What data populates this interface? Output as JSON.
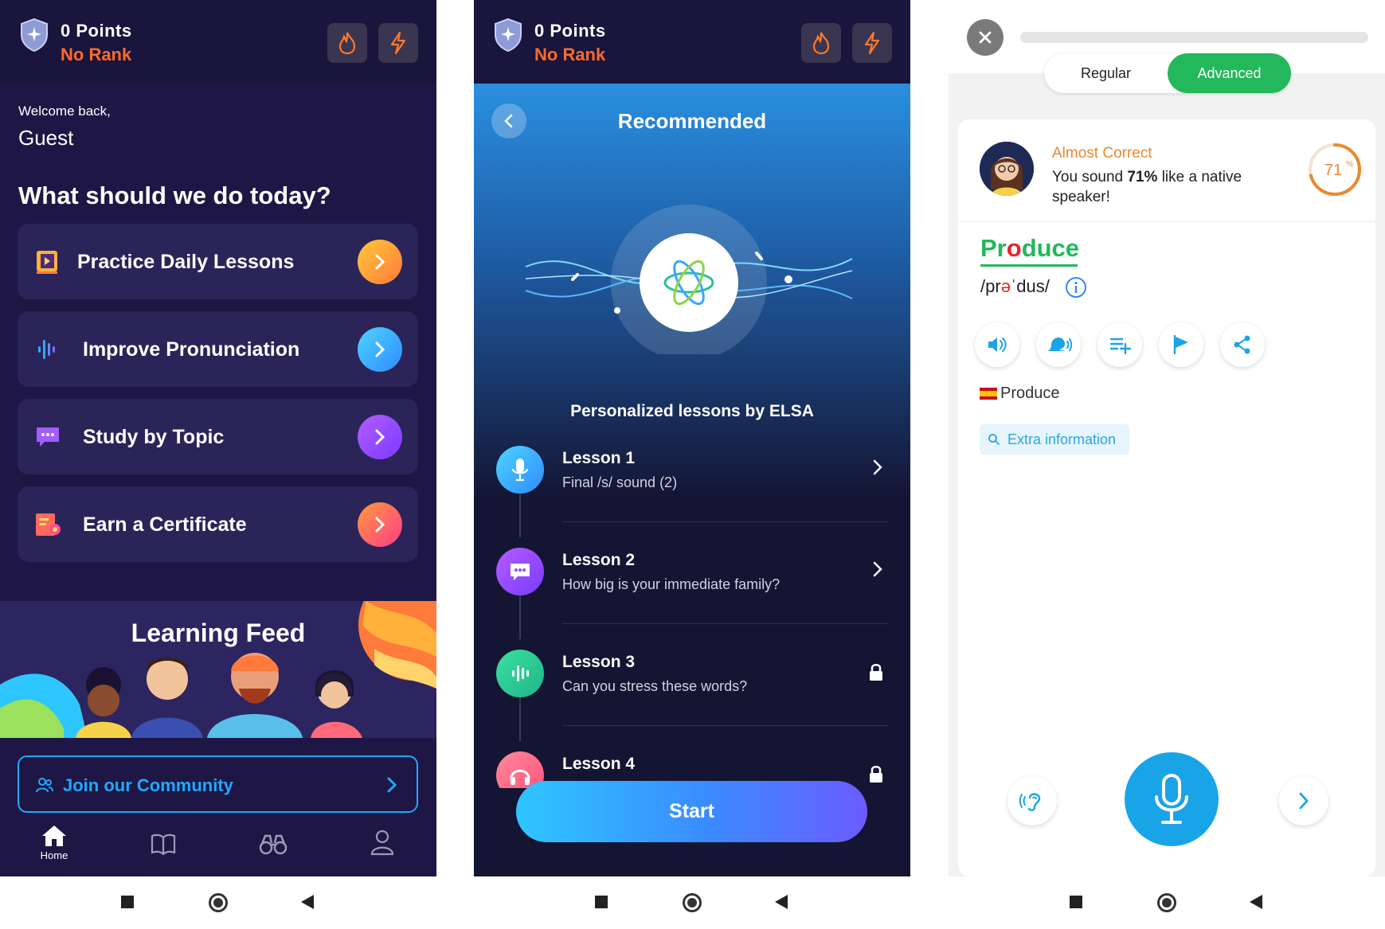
{
  "colors": {
    "accent_blue": "#1fa9ff",
    "rank_orange": "#ff6a2b",
    "green": "#22b85b",
    "elsa_red": "#e8232b"
  },
  "home": {
    "points": "0 Points",
    "rank": "No Rank",
    "welcome": "Welcome back,",
    "user": "Guest",
    "question": "What should we do today?",
    "cards": [
      {
        "label": "Practice Daily Lessons",
        "icon": "book-video-icon"
      },
      {
        "label": "Improve Pronunciation",
        "icon": "sound-wave-icon"
      },
      {
        "label": "Study by Topic",
        "icon": "chat-bubble-icon"
      },
      {
        "label": "Earn a Certificate",
        "icon": "certificate-icon"
      }
    ],
    "feed_title": "Learning Feed",
    "community": "Join our Community",
    "tabs": [
      {
        "label": "Home",
        "icon": "home-icon"
      },
      {
        "label": "",
        "icon": "book-icon"
      },
      {
        "label": "",
        "icon": "binoculars-icon"
      },
      {
        "label": "",
        "icon": "profile-icon"
      }
    ]
  },
  "recommended": {
    "points": "0 Points",
    "rank": "No Rank",
    "title": "Recommended",
    "subtitle": "Personalized lessons by ELSA",
    "lessons": [
      {
        "title": "Lesson 1",
        "desc": "Final /s/ sound (2)",
        "state": "open"
      },
      {
        "title": "Lesson 2",
        "desc": "How big is your immediate family?",
        "state": "open"
      },
      {
        "title": "Lesson 3",
        "desc": "Can you stress these words?",
        "state": "locked"
      },
      {
        "title": "Lesson 4",
        "desc": "",
        "state": "locked"
      }
    ],
    "start": "Start"
  },
  "practice": {
    "mode_regular": "Regular",
    "mode_advanced": "Advanced",
    "selected_mode": "Advanced",
    "feedback": "Almost Correct",
    "score_prefix": "You sound ",
    "score": "71%",
    "score_suffix": " like a native speaker!",
    "ring_value": "71",
    "ring_unit": "%",
    "ring_fraction": 0.71,
    "word_parts": [
      "Pr",
      "o",
      "duce"
    ],
    "ipa_parts": [
      "/pr",
      "ə",
      "ˈdus/"
    ],
    "translation": "Produce",
    "extra": "Extra information"
  }
}
